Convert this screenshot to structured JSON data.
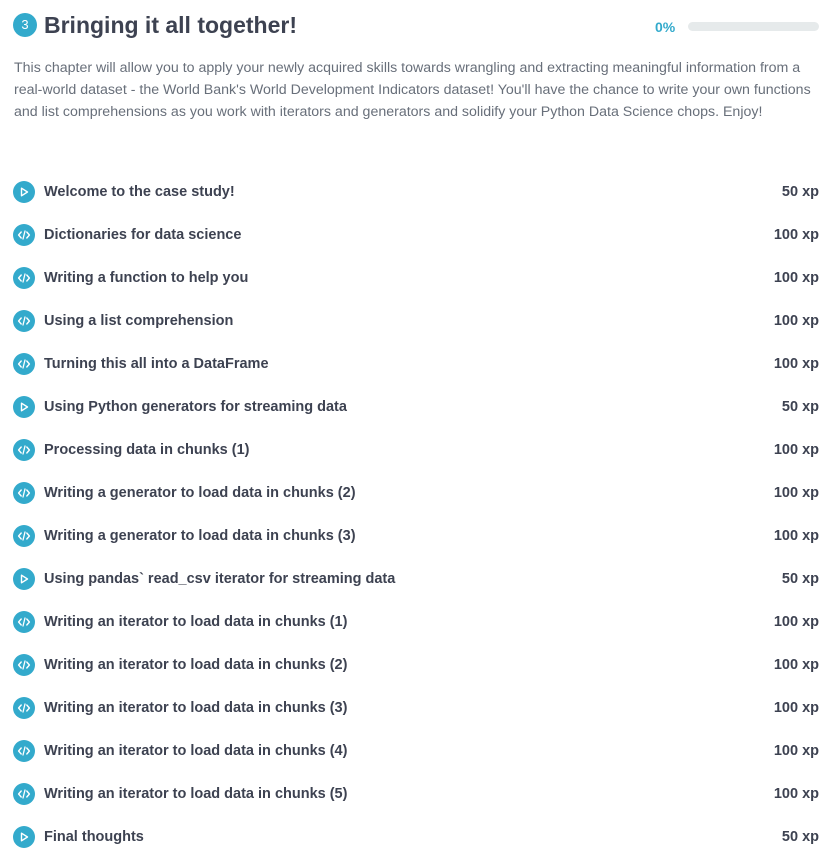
{
  "chapter": {
    "number": "3",
    "title": "Bringing it all together!",
    "progress_text": "0%",
    "progress_fraction": 0,
    "description": "This chapter will allow you to apply your newly acquired skills towards wrangling and extracting meaningful information from a real-world dataset - the World Bank's World Development Indicators dataset! You'll have the chance to write your own functions and list comprehensions as you work with iterators and generators and solidify your Python Data Science chops. Enjoy!"
  },
  "colors": {
    "accent": "#33aacc",
    "title_text": "#3d4251",
    "body_text": "#686f7a",
    "track": "#e6eaeb"
  },
  "exercises": [
    {
      "icon": "video-play-icon",
      "title": "Welcome to the case study!",
      "xp": "50 xp"
    },
    {
      "icon": "code-icon",
      "title": "Dictionaries for data science",
      "xp": "100 xp"
    },
    {
      "icon": "code-icon",
      "title": "Writing a function to help you",
      "xp": "100 xp"
    },
    {
      "icon": "code-icon",
      "title": "Using a list comprehension",
      "xp": "100 xp"
    },
    {
      "icon": "code-icon",
      "title": "Turning this all into a DataFrame",
      "xp": "100 xp"
    },
    {
      "icon": "video-play-icon",
      "title": "Using Python generators for streaming data",
      "xp": "50 xp"
    },
    {
      "icon": "code-icon",
      "title": "Processing data in chunks (1)",
      "xp": "100 xp"
    },
    {
      "icon": "code-icon",
      "title": "Writing a generator to load data in chunks (2)",
      "xp": "100 xp"
    },
    {
      "icon": "code-icon",
      "title": "Writing a generator to load data in chunks (3)",
      "xp": "100 xp"
    },
    {
      "icon": "video-play-icon",
      "title": "Using pandas` read_csv iterator for streaming data",
      "xp": "50 xp"
    },
    {
      "icon": "code-icon",
      "title": "Writing an iterator to load data in chunks (1)",
      "xp": "100 xp"
    },
    {
      "icon": "code-icon",
      "title": "Writing an iterator to load data in chunks (2)",
      "xp": "100 xp"
    },
    {
      "icon": "code-icon",
      "title": "Writing an iterator to load data in chunks (3)",
      "xp": "100 xp"
    },
    {
      "icon": "code-icon",
      "title": "Writing an iterator to load data in chunks (4)",
      "xp": "100 xp"
    },
    {
      "icon": "code-icon",
      "title": "Writing an iterator to load data in chunks (5)",
      "xp": "100 xp"
    },
    {
      "icon": "video-play-icon",
      "title": "Final thoughts",
      "xp": "50 xp"
    }
  ]
}
